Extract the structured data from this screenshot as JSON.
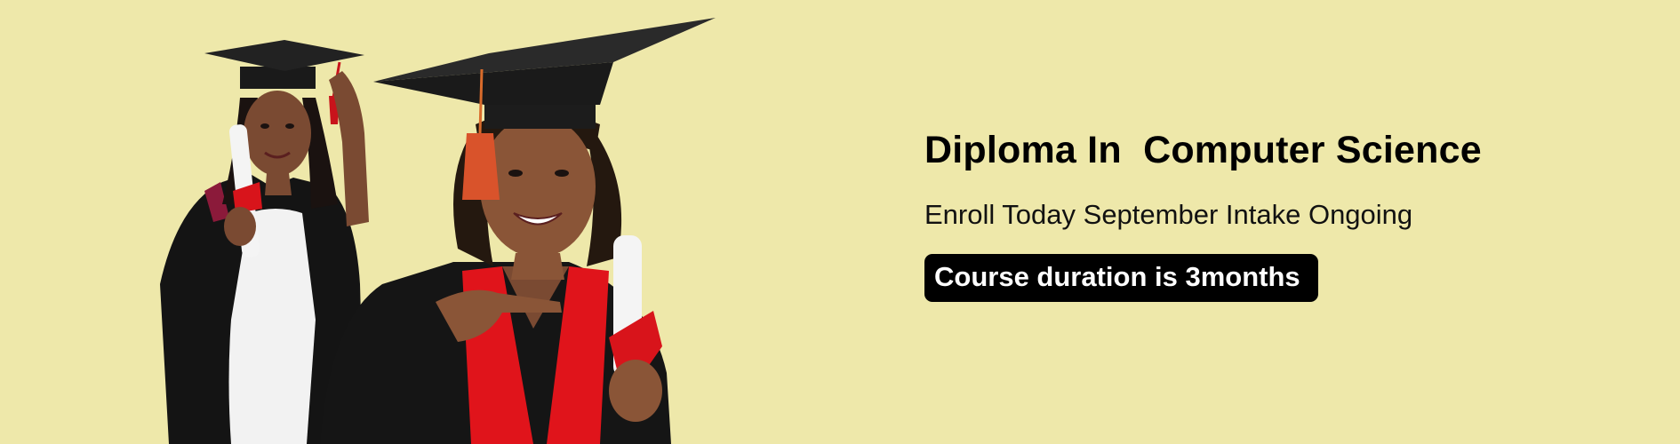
{
  "banner": {
    "background_color": "#EEE8AA",
    "headline": "Diploma In  Computer Science",
    "subline": "Enroll Today September Intake Ongoing",
    "duration_badge": "Course duration is 3months",
    "badge_color": "#000000",
    "accent_color": "#E0141B"
  },
  "photo": {
    "subjects": [
      "graduate-left-holding-diploma",
      "graduate-right-pointing-at-diploma"
    ]
  }
}
